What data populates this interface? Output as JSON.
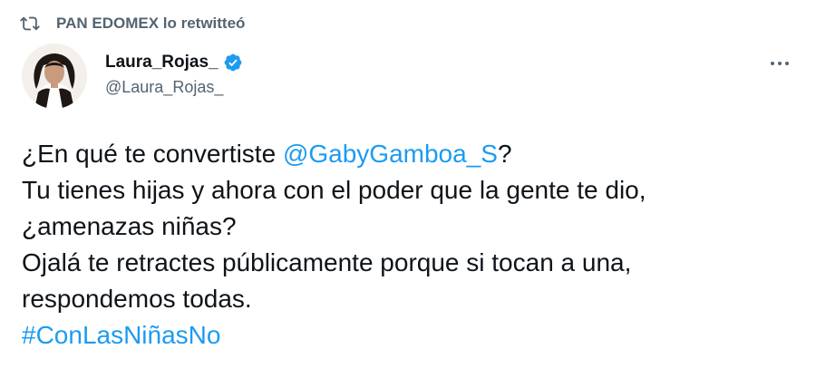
{
  "retweet": {
    "icon": "retweet-icon",
    "label": "PAN EDOMEX lo retwitteó"
  },
  "author": {
    "avatar": "avatar",
    "display_name": "Laura_Rojas_",
    "verified_icon": "verified-badge-icon",
    "handle": "@Laura_Rojas_"
  },
  "menu": {
    "icon": "more-icon"
  },
  "tweet": {
    "line1_text": "¿En qué te convertiste ",
    "mention": "@GabyGamboa_S",
    "line1_end": "?",
    "line2": "Tu tienes hijas y ahora con el poder que la gente te dio,",
    "line3": "¿amenazas niñas?",
    "line4": "Ojalá te retractes públicamente porque si tocan a una,",
    "line5": "respondemos todas.",
    "hashtag": "#ConLasNiñasNo"
  },
  "colors": {
    "link": "#1d9bf0",
    "secondary_text": "#536471",
    "primary_text": "#0f1419",
    "background": "#ffffff"
  }
}
